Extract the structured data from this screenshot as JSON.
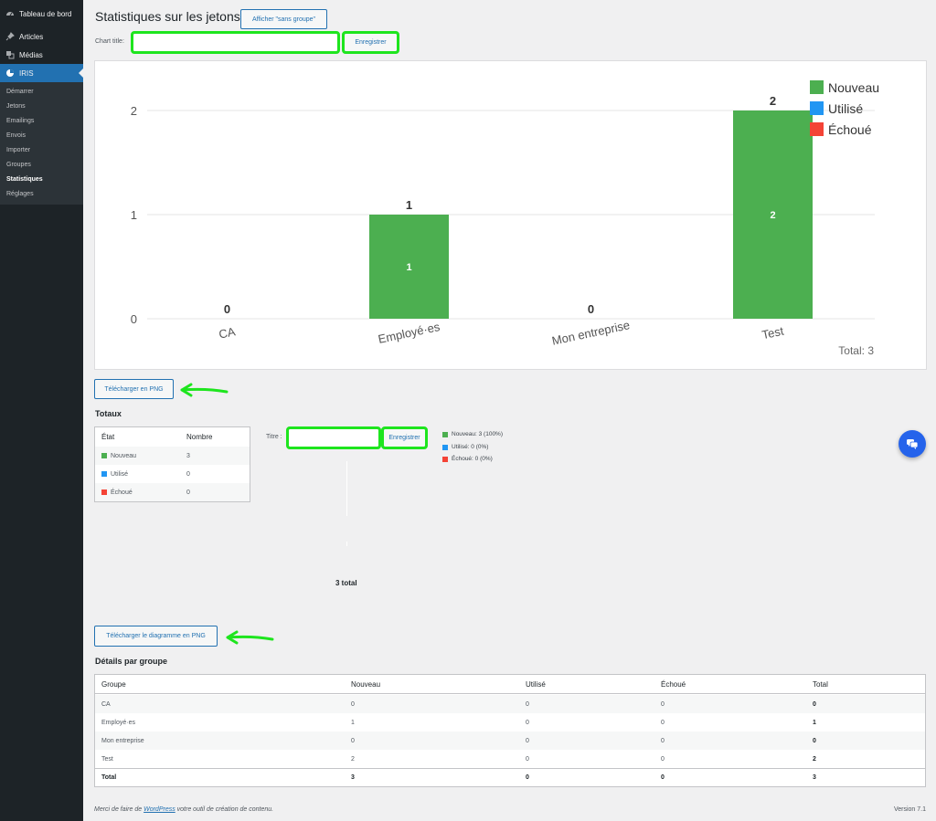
{
  "sidebar": {
    "items": [
      {
        "label": "Tableau de bord",
        "icon": "dashboard-icon"
      },
      {
        "label": "Articles",
        "icon": "pin-icon"
      },
      {
        "label": "Médias",
        "icon": "media-icon"
      },
      {
        "label": "IRIS",
        "icon": "pie-chart-icon"
      }
    ],
    "submenu": [
      "Démarrer",
      "Jetons",
      "Emailings",
      "Envois",
      "Importer",
      "Groupes",
      "Statistiques",
      "Réglages"
    ]
  },
  "header": {
    "title": "Statistiques sur les jetons",
    "toggle_button": "Afficher \"sans groupe\""
  },
  "chart_form": {
    "label": "Chart title:",
    "value": "",
    "save": "Enregistrer"
  },
  "chart_data": {
    "type": "bar",
    "categories": [
      "CA",
      "Employé·es",
      "Mon entreprise",
      "Test"
    ],
    "series": [
      {
        "name": "Nouveau",
        "values": [
          0,
          1,
          0,
          2
        ],
        "color": "#4caf50"
      },
      {
        "name": "Utilisé",
        "values": [
          0,
          0,
          0,
          0
        ],
        "color": "#2196f3"
      },
      {
        "name": "Échoué",
        "values": [
          0,
          0,
          0,
          0
        ],
        "color": "#f44336"
      }
    ],
    "ylim": [
      0,
      2
    ],
    "yticks": [
      0,
      1,
      2
    ],
    "total_label": "Total: 3",
    "legend_position": "top-right",
    "grid": true
  },
  "download_png": "Télécharger en PNG",
  "totaux": {
    "heading": "Totaux",
    "col_state": "État",
    "col_count": "Nombre",
    "rows": [
      {
        "label": "Nouveau",
        "count": "3",
        "color": "#4caf50"
      },
      {
        "label": "Utilisé",
        "count": "0",
        "color": "#2196f3"
      },
      {
        "label": "Échoué",
        "count": "0",
        "color": "#f44336"
      }
    ]
  },
  "donut_form": {
    "label": "Titre :",
    "value": "",
    "save": "Enregistrer"
  },
  "donut_legend": [
    "Nouveau: 3 (100%)",
    "Utilisé: 0 (0%)",
    "Échoué: 0 (0%)"
  ],
  "donut_total": "3 total",
  "download_diagram": "Télécharger le diagramme en PNG",
  "details": {
    "heading": "Détails par groupe",
    "columns": [
      "Groupe",
      "Nouveau",
      "Utilisé",
      "Échoué",
      "Total"
    ],
    "rows": [
      [
        "CA",
        "0",
        "0",
        "0",
        "0"
      ],
      [
        "Employé·es",
        "1",
        "0",
        "0",
        "1"
      ],
      [
        "Mon entreprise",
        "0",
        "0",
        "0",
        "0"
      ],
      [
        "Test",
        "2",
        "0",
        "0",
        "2"
      ]
    ],
    "footer": [
      "Total",
      "3",
      "0",
      "0",
      "3"
    ]
  },
  "footer": {
    "prefix": "Merci de faire de ",
    "link": "WordPress",
    "suffix": " votre outil de création de contenu.",
    "version": "Version 7.1"
  }
}
